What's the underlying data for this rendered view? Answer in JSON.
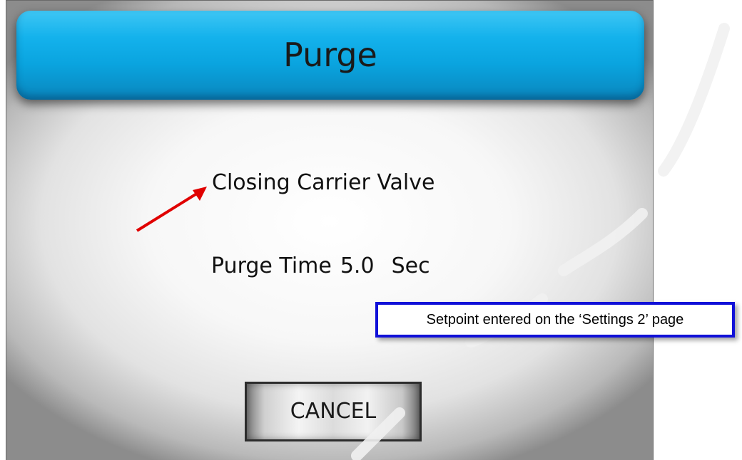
{
  "dialog": {
    "title": "Purge",
    "status": "Closing Carrier Valve",
    "purge_time": {
      "label": "Purge Time",
      "value": "5.0",
      "unit": "Sec"
    },
    "cancel_label": "CANCEL"
  },
  "annotation": {
    "text": "Setpoint entered on the ‘Settings 2’ page",
    "border_color": "#1010d8",
    "arrow_color": "#e00000"
  },
  "colors": {
    "title_bar": "#0aa4df"
  }
}
